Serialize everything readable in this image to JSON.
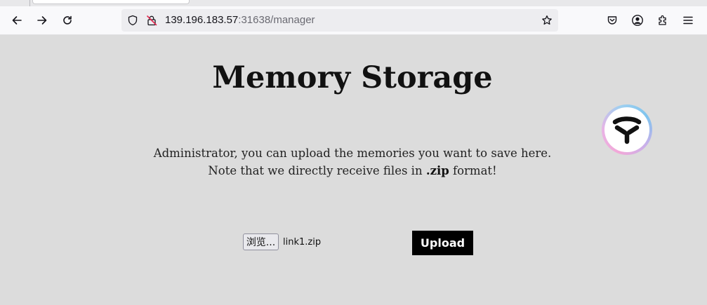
{
  "browser": {
    "url_host": "139.196.183.57",
    "url_rest": ":31638/manager",
    "icons": [
      "back-arrow-icon",
      "forward-arrow-icon",
      "reload-icon",
      "shield-icon",
      "insecure-lock-icon",
      "bookmark-star-icon",
      "pocket-icon",
      "account-icon",
      "extensions-icon",
      "menu-icon"
    ]
  },
  "page": {
    "title": "Memory Storage",
    "desc_line1": "Administrator, you can upload the memories you want to save here.",
    "desc_line2_prefix": "Note that we directly receive files in ",
    "desc_line2_bold": ".zip",
    "desc_line2_suffix": " format!",
    "file_button_label": "浏览...",
    "file_name": "link1.zip",
    "upload_label": "Upload",
    "badge_icon": "y-logo-icon"
  },
  "colors": {
    "page_bg": "#dcdcdc",
    "upload_bg": "#000000",
    "badge_gradient": [
      "#f2a8d8",
      "#9fd0f0"
    ]
  }
}
